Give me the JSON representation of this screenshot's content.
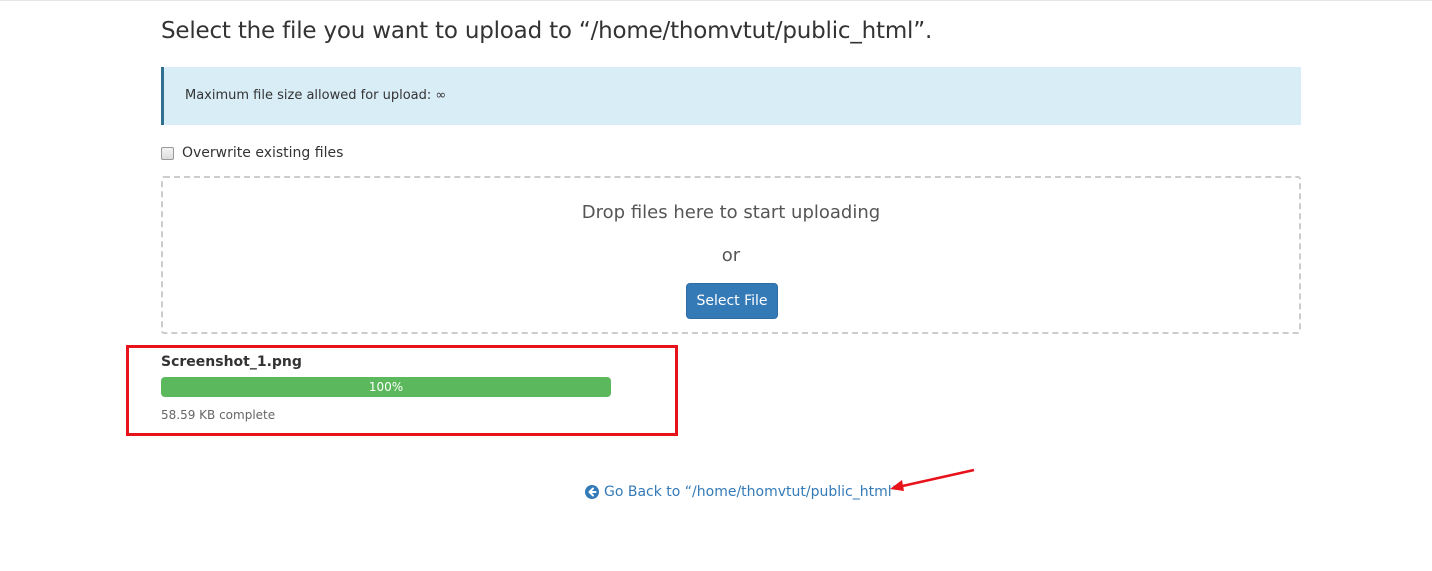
{
  "page": {
    "title": "Select the file you want to upload to “/home/thomvtut/public_html”.",
    "info_alert": "Maximum file size allowed for upload: ∞",
    "overwrite": {
      "label": "Overwrite existing files",
      "checked": false
    },
    "dropzone": {
      "drop_text": "Drop files here to start uploading",
      "or_text": "or",
      "select_button": "Select File"
    },
    "upload": {
      "file_name": "Screenshot_1.png",
      "progress_percent": 100,
      "progress_label": "100%",
      "status": "58.59 KB complete"
    },
    "go_back": {
      "label": "Go Back to “/home/thomvtut/public_html”",
      "icon": "arrow-circle-left-icon"
    }
  },
  "colors": {
    "alert_bg": "#d9edf7",
    "alert_border": "#31708f",
    "primary": "#337ab7",
    "success": "#5cb85c",
    "annotation_red": "#e8121a"
  }
}
